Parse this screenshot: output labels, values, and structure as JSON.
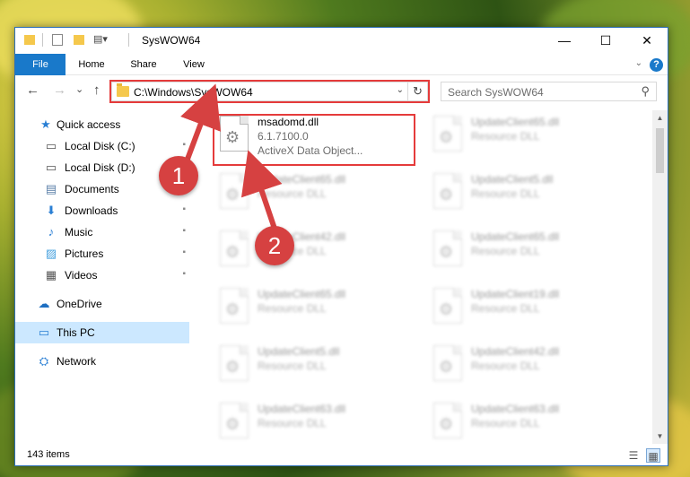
{
  "window": {
    "title": "SysWOW64",
    "minimize_glyph": "—",
    "maximize_glyph": "☐",
    "close_glyph": "✕"
  },
  "ribbon": {
    "tabs": [
      "File",
      "Home",
      "Share",
      "View"
    ],
    "help_glyph": "?",
    "collapse_glyph": "⌄"
  },
  "nav": {
    "back_glyph": "←",
    "forward_glyph": "→",
    "recent_glyph": "⌄",
    "up_glyph": "↑",
    "address": "C:\\Windows\\SysWOW64",
    "address_dropdown_glyph": "⌄",
    "refresh_glyph": "↻",
    "search_placeholder": "Search SysWOW64",
    "search_glyph": "⚲"
  },
  "sidebar": {
    "items": [
      {
        "label": "Quick access",
        "icon": "star-icon",
        "glyph": "★",
        "color": "#2a7fd4",
        "pinned": false
      },
      {
        "label": "Local Disk (C:)",
        "icon": "drive-icon",
        "glyph": "▭",
        "color": "#555555",
        "pinned": true
      },
      {
        "label": "Local Disk (D:)",
        "icon": "drive-icon",
        "glyph": "▭",
        "color": "#555555",
        "pinned": false
      },
      {
        "label": "Documents",
        "icon": "documents-icon",
        "glyph": "▤",
        "color": "#5a7fa8",
        "pinned": true
      },
      {
        "label": "Downloads",
        "icon": "downloads-icon",
        "glyph": "⬇",
        "color": "#2a7fd4",
        "pinned": true
      },
      {
        "label": "Music",
        "icon": "music-icon",
        "glyph": "♪",
        "color": "#2a7fd4",
        "pinned": true
      },
      {
        "label": "Pictures",
        "icon": "pictures-icon",
        "glyph": "▨",
        "color": "#4aa3df",
        "pinned": true
      },
      {
        "label": "Videos",
        "icon": "videos-icon",
        "glyph": "▦",
        "color": "#555555",
        "pinned": true
      },
      {
        "label": "OneDrive",
        "icon": "onedrive-icon",
        "glyph": "☁",
        "color": "#1e6fc1",
        "pinned": false
      },
      {
        "label": "This PC",
        "icon": "this-pc-icon",
        "glyph": "▭",
        "color": "#2a7fd4",
        "pinned": false,
        "selected": true
      },
      {
        "label": "Network",
        "icon": "network-icon",
        "glyph": "⛭",
        "color": "#2a7fd4",
        "pinned": false
      }
    ],
    "pin_glyph": "📌"
  },
  "files": {
    "highlighted": {
      "name": "msadomd.dll",
      "version": "6.1.7100.0",
      "description": "ActiveX Data Object..."
    },
    "blurred_left": [
      {
        "name": "UpdateClient65.dll",
        "type": "Resource DLL"
      },
      {
        "name": "UpdateClient42.dll",
        "type": "Resource DLL"
      },
      {
        "name": "UpdateClient65.dll",
        "type": "Resource DLL"
      },
      {
        "name": "UpdateClient5.dll",
        "type": "Resource DLL"
      },
      {
        "name": "UpdateClient63.dll",
        "type": "Resource DLL"
      }
    ],
    "blurred_right": [
      {
        "name": "UpdateClient65.dll",
        "type": "Resource DLL"
      },
      {
        "name": "UpdateClient5.dll",
        "type": "Resource DLL"
      },
      {
        "name": "UpdateClient65.dll",
        "type": "Resource DLL"
      },
      {
        "name": "UpdateClient19.dll",
        "type": "Resource DLL"
      },
      {
        "name": "UpdateClient42.dll",
        "type": "Resource DLL"
      },
      {
        "name": "UpdateClient63.dll",
        "type": "Resource DLL"
      }
    ],
    "gear_glyph": "⚙"
  },
  "status": {
    "items_count": "143 items",
    "details_view_glyph": "☰",
    "tiles_view_glyph": "▦"
  },
  "callouts": {
    "one": "1",
    "two": "2"
  },
  "colors": {
    "accent": "#1979ca",
    "callout": "#d64141",
    "highlight_box": "#e53b3b",
    "selected_nav": "#cce8ff"
  }
}
